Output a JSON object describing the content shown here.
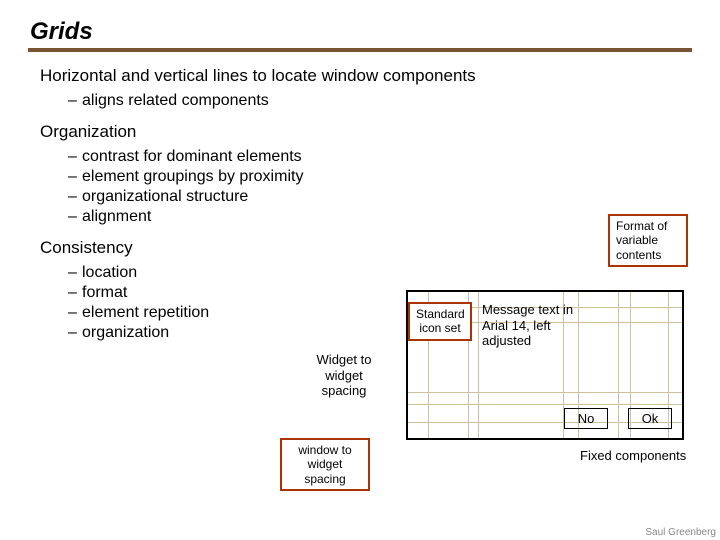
{
  "title": "Grids",
  "topics": {
    "horizontal": {
      "heading": "Horizontal and vertical lines to locate window components",
      "items": [
        "aligns related components"
      ]
    },
    "organization": {
      "heading": "Organization",
      "items": [
        "contrast for dominant elements",
        "element groupings by proximity",
        "organizational structure",
        "alignment"
      ]
    },
    "consistency": {
      "heading": "Consistency",
      "items": [
        "location",
        "format",
        "element repetition",
        "organization"
      ]
    }
  },
  "diagram": {
    "format_label": "Format of variable contents",
    "standard_icon": "Standard icon set",
    "message_text": "Message text in Arial 14, left adjusted",
    "widget_spacing": "Widget to widget spacing",
    "window_spacing": "window to widget spacing",
    "no_btn": "No",
    "ok_btn": "Ok",
    "fixed_components": "Fixed components"
  },
  "footer": "Saul Greenberg"
}
